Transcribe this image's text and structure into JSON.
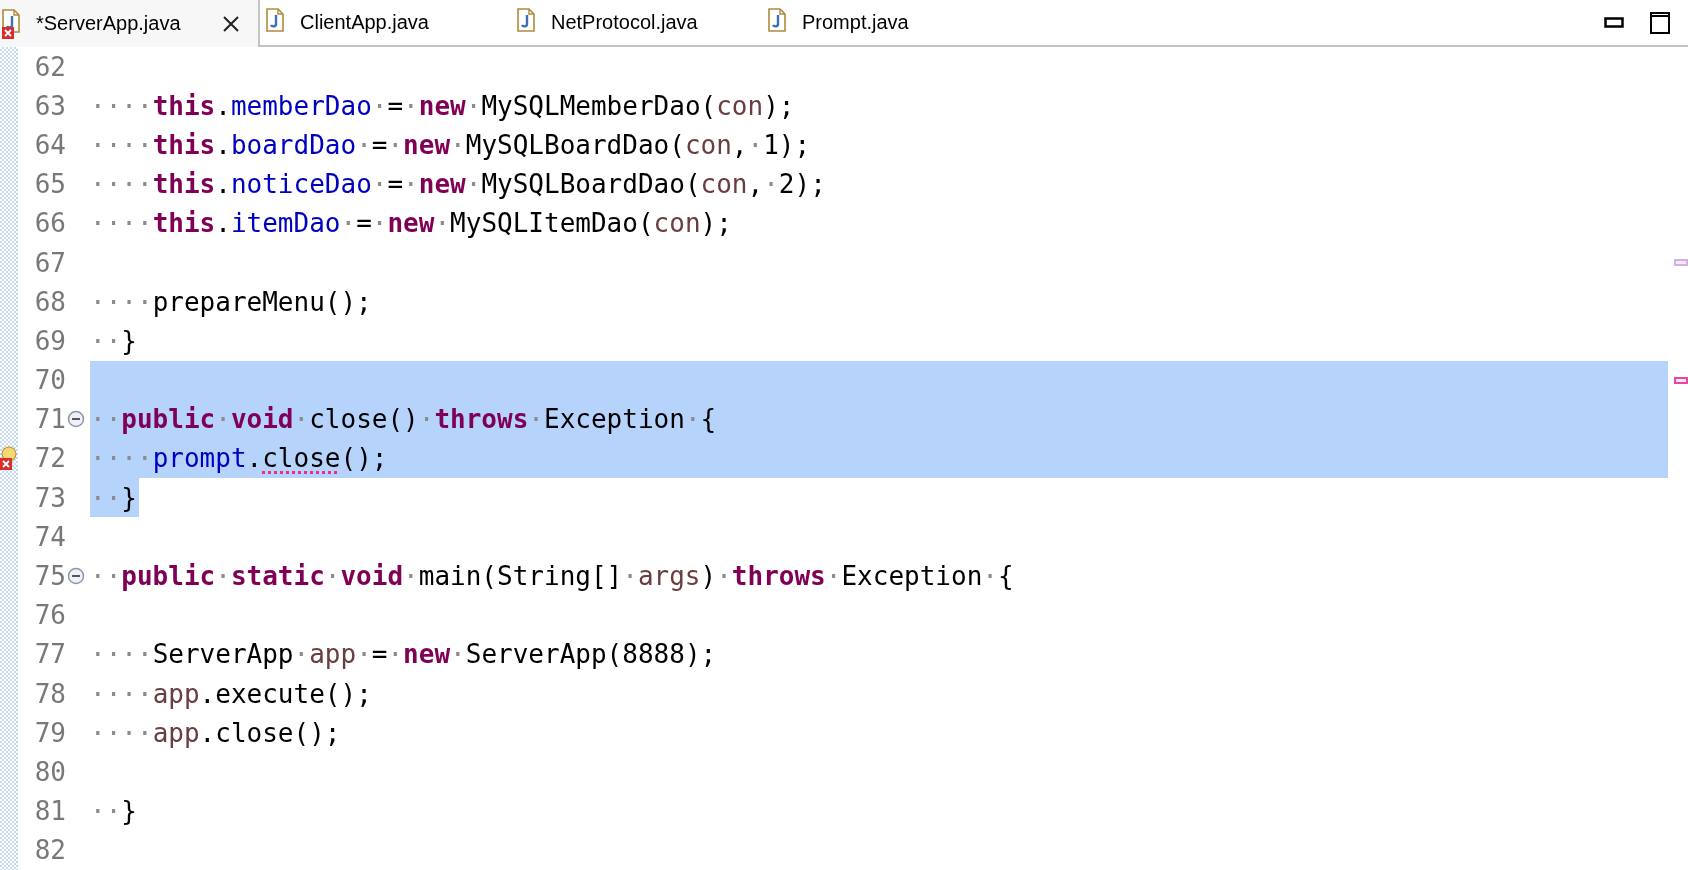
{
  "tabs": [
    {
      "label": "*ServerApp.java",
      "selected": true,
      "error": true
    },
    {
      "label": "ClientApp.java",
      "selected": false,
      "error": false
    },
    {
      "label": "NetProtocol.java",
      "selected": false,
      "error": false
    },
    {
      "label": "Prompt.java",
      "selected": false,
      "error": false
    }
  ],
  "lines": [
    {
      "number": "62",
      "selected": false
    },
    {
      "number": "63",
      "selected": false,
      "tokens": [
        {
          "text": "····",
          "kind": "ws"
        },
        {
          "text": "this",
          "kind": "kw"
        },
        {
          "text": ".",
          "kind": "plain"
        },
        {
          "text": "memberDao",
          "kind": "field"
        },
        {
          "text": "·",
          "kind": "ws"
        },
        {
          "text": "=",
          "kind": "plain"
        },
        {
          "text": "·",
          "kind": "ws"
        },
        {
          "text": "new",
          "kind": "kw"
        },
        {
          "text": "·",
          "kind": "ws"
        },
        {
          "text": "MySQLMemberDao(",
          "kind": "plain"
        },
        {
          "text": "con",
          "kind": "var"
        },
        {
          "text": ");",
          "kind": "plain"
        }
      ]
    },
    {
      "number": "64",
      "selected": false,
      "tokens": [
        {
          "text": "····",
          "kind": "ws"
        },
        {
          "text": "this",
          "kind": "kw"
        },
        {
          "text": ".",
          "kind": "plain"
        },
        {
          "text": "boardDao",
          "kind": "field"
        },
        {
          "text": "·",
          "kind": "ws"
        },
        {
          "text": "=",
          "kind": "plain"
        },
        {
          "text": "·",
          "kind": "ws"
        },
        {
          "text": "new",
          "kind": "kw"
        },
        {
          "text": "·",
          "kind": "ws"
        },
        {
          "text": "MySQLBoardDao(",
          "kind": "plain"
        },
        {
          "text": "con",
          "kind": "var"
        },
        {
          "text": ",",
          "kind": "plain"
        },
        {
          "text": "·",
          "kind": "ws"
        },
        {
          "text": "1);",
          "kind": "plain"
        }
      ]
    },
    {
      "number": "65",
      "selected": false,
      "tokens": [
        {
          "text": "····",
          "kind": "ws"
        },
        {
          "text": "this",
          "kind": "kw"
        },
        {
          "text": ".",
          "kind": "plain"
        },
        {
          "text": "noticeDao",
          "kind": "field"
        },
        {
          "text": "·",
          "kind": "ws"
        },
        {
          "text": "=",
          "kind": "plain"
        },
        {
          "text": "·",
          "kind": "ws"
        },
        {
          "text": "new",
          "kind": "kw"
        },
        {
          "text": "·",
          "kind": "ws"
        },
        {
          "text": "MySQLBoardDao(",
          "kind": "plain"
        },
        {
          "text": "con",
          "kind": "var"
        },
        {
          "text": ",",
          "kind": "plain"
        },
        {
          "text": "·",
          "kind": "ws"
        },
        {
          "text": "2);",
          "kind": "plain"
        }
      ]
    },
    {
      "number": "66",
      "selected": false,
      "tokens": [
        {
          "text": "····",
          "kind": "ws"
        },
        {
          "text": "this",
          "kind": "kw"
        },
        {
          "text": ".",
          "kind": "plain"
        },
        {
          "text": "itemDao",
          "kind": "field"
        },
        {
          "text": "·",
          "kind": "ws"
        },
        {
          "text": "=",
          "kind": "plain"
        },
        {
          "text": "·",
          "kind": "ws"
        },
        {
          "text": "new",
          "kind": "kw"
        },
        {
          "text": "·",
          "kind": "ws"
        },
        {
          "text": "MySQLItemDao(",
          "kind": "plain"
        },
        {
          "text": "con",
          "kind": "var"
        },
        {
          "text": ");",
          "kind": "plain"
        }
      ]
    },
    {
      "number": "67",
      "selected": false,
      "overview_marker": {
        "color": "#cfb3de"
      }
    },
    {
      "number": "68",
      "selected": false,
      "tokens": [
        {
          "text": "····",
          "kind": "ws"
        },
        {
          "text": "prepareMenu();",
          "kind": "plain"
        }
      ]
    },
    {
      "number": "69",
      "selected": false,
      "tokens": [
        {
          "text": "··",
          "kind": "ws"
        },
        {
          "text": "}",
          "kind": "plain"
        }
      ]
    },
    {
      "number": "70",
      "selected": true,
      "overview_marker": {
        "color": "#e8479d"
      }
    },
    {
      "number": "71",
      "selected": true,
      "fold_expanded": true,
      "tokens": [
        {
          "text": "··",
          "kind": "ws"
        },
        {
          "text": "public",
          "kind": "kw"
        },
        {
          "text": "·",
          "kind": "ws"
        },
        {
          "text": "void",
          "kind": "kw"
        },
        {
          "text": "·",
          "kind": "ws"
        },
        {
          "text": "close()",
          "kind": "plain"
        },
        {
          "text": "·",
          "kind": "ws"
        },
        {
          "text": "throws",
          "kind": "kw"
        },
        {
          "text": "·",
          "kind": "ws"
        },
        {
          "text": "Exception",
          "kind": "plain"
        },
        {
          "text": "·",
          "kind": "ws"
        },
        {
          "text": "{",
          "kind": "plain"
        }
      ]
    },
    {
      "number": "72",
      "selected": true,
      "error": true,
      "tokens": [
        {
          "text": "····",
          "kind": "ws"
        },
        {
          "text": "prompt",
          "kind": "field"
        },
        {
          "text": ".",
          "kind": "plain"
        },
        {
          "text": "close",
          "kind": "plain",
          "error": true
        },
        {
          "text": "();",
          "kind": "plain"
        }
      ]
    },
    {
      "number": "73",
      "selected": true,
      "selection_ends_at_text": true,
      "tokens": [
        {
          "text": "··",
          "kind": "ws"
        },
        {
          "text": "}",
          "kind": "plain"
        }
      ]
    },
    {
      "number": "74",
      "selected": false
    },
    {
      "number": "75",
      "selected": false,
      "fold_expanded": true,
      "tokens": [
        {
          "text": "··",
          "kind": "ws"
        },
        {
          "text": "public",
          "kind": "kw"
        },
        {
          "text": "·",
          "kind": "ws"
        },
        {
          "text": "static",
          "kind": "kw"
        },
        {
          "text": "·",
          "kind": "ws"
        },
        {
          "text": "void",
          "kind": "kw"
        },
        {
          "text": "·",
          "kind": "ws"
        },
        {
          "text": "main(String[]",
          "kind": "plain"
        },
        {
          "text": "·",
          "kind": "ws"
        },
        {
          "text": "args",
          "kind": "var"
        },
        {
          "text": ")",
          "kind": "plain"
        },
        {
          "text": "·",
          "kind": "ws"
        },
        {
          "text": "throws",
          "kind": "kw"
        },
        {
          "text": "·",
          "kind": "ws"
        },
        {
          "text": "Exception",
          "kind": "plain"
        },
        {
          "text": "·",
          "kind": "ws"
        },
        {
          "text": "{",
          "kind": "plain"
        }
      ]
    },
    {
      "number": "76",
      "selected": false
    },
    {
      "number": "77",
      "selected": false,
      "tokens": [
        {
          "text": "····",
          "kind": "ws"
        },
        {
          "text": "ServerApp",
          "kind": "plain"
        },
        {
          "text": "·",
          "kind": "ws"
        },
        {
          "text": "app",
          "kind": "var"
        },
        {
          "text": "·",
          "kind": "ws"
        },
        {
          "text": "=",
          "kind": "plain"
        },
        {
          "text": "·",
          "kind": "ws"
        },
        {
          "text": "new",
          "kind": "kw"
        },
        {
          "text": "·",
          "kind": "ws"
        },
        {
          "text": "ServerApp(8888);",
          "kind": "plain"
        }
      ]
    },
    {
      "number": "78",
      "selected": false,
      "tokens": [
        {
          "text": "····",
          "kind": "ws"
        },
        {
          "text": "app",
          "kind": "var"
        },
        {
          "text": ".execute();",
          "kind": "plain"
        }
      ]
    },
    {
      "number": "79",
      "selected": false,
      "tokens": [
        {
          "text": "····",
          "kind": "ws"
        },
        {
          "text": "app",
          "kind": "var"
        },
        {
          "text": ".close();",
          "kind": "plain"
        }
      ]
    },
    {
      "number": "80",
      "selected": false
    },
    {
      "number": "81",
      "selected": false,
      "tokens": [
        {
          "text": "··",
          "kind": "ws"
        },
        {
          "text": "}",
          "kind": "plain"
        }
      ]
    },
    {
      "number": "82",
      "selected": false
    }
  ]
}
